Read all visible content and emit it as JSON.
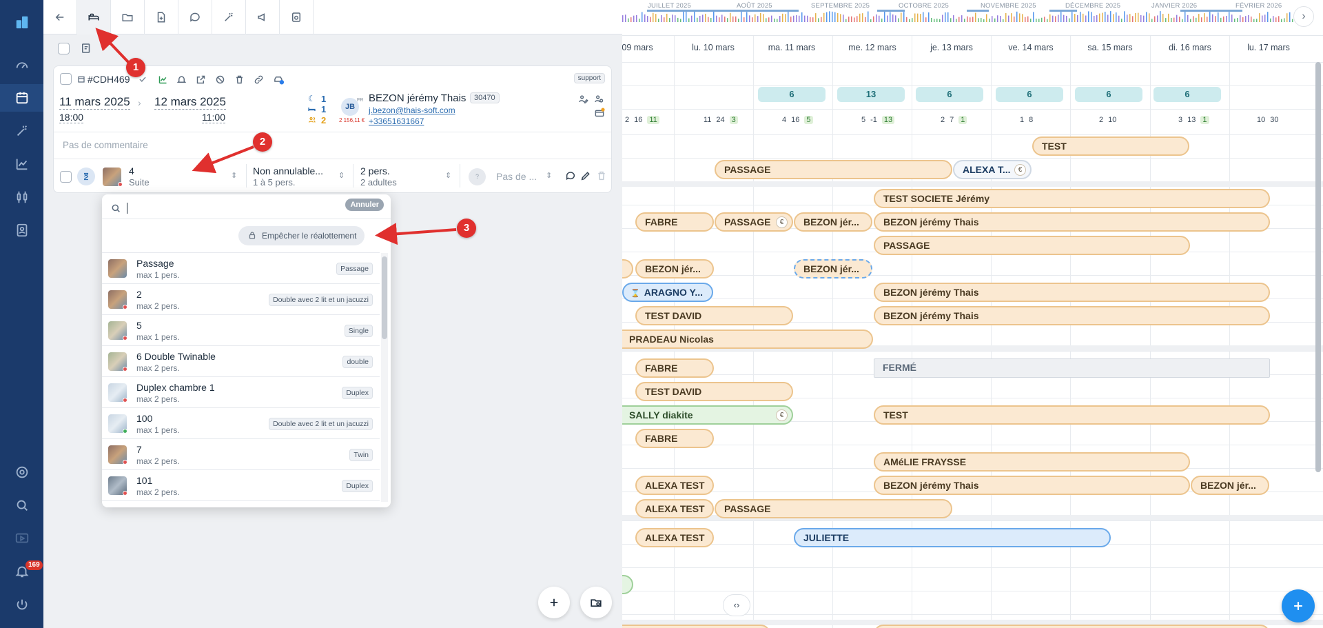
{
  "sidebar": {
    "notification_count": "169"
  },
  "booking": {
    "ref": "#CDH469",
    "support_label": "support",
    "arrival_date": "11 mars 2025",
    "arrival_time": "18:00",
    "departure_date": "12 mars 2025",
    "departure_time": "11:00",
    "nights": "1",
    "rooms": "1",
    "guests": "2",
    "initials": "JB",
    "lang": "FR",
    "amount": "2 156,11 €",
    "client_name": "BEZON jérémy Thais",
    "client_code": "30470",
    "email": "j.bezon@thais-soft.com",
    "phone": "+33651631667",
    "comment_placeholder": "Pas de commentaire"
  },
  "line": {
    "room_number": "4",
    "room_type": "Suite",
    "rate": "Non annulable...",
    "rate_sub": "1 à 5 pers.",
    "pax": "2 pers.",
    "pax_sub": "2 adultes",
    "note": "Pas de ...",
    "unknown": "?"
  },
  "dropdown": {
    "cancel_label": "Annuler",
    "lock_label": "Empêcher le réalottement",
    "rooms": [
      {
        "name": "Passage",
        "cap": "max 1 pers.",
        "tag": "Passage"
      },
      {
        "name": "2",
        "cap": "max 2 pers.",
        "tag": "Double avec 2 lit et un jacuzzi"
      },
      {
        "name": "5",
        "cap": "max 1 pers.",
        "tag": "Single"
      },
      {
        "name": "6 Double Twinable",
        "cap": "max 2 pers.",
        "tag": "double"
      },
      {
        "name": "Duplex chambre 1",
        "cap": "max 2 pers.",
        "tag": "Duplex"
      },
      {
        "name": "100",
        "cap": "max 1 pers.",
        "tag": "Double avec 2 lit et un jacuzzi"
      },
      {
        "name": "7",
        "cap": "max 2 pers.",
        "tag": "Twin"
      },
      {
        "name": "101",
        "cap": "max 2 pers.",
        "tag": "Duplex"
      }
    ]
  },
  "markers": [
    "1",
    "2",
    "3"
  ],
  "calendar": {
    "months": [
      "JUILLET 2025",
      "AOÛT 2025",
      "SEPTEMBRE 2025",
      "OCTOBRE 2025",
      "NOVEMBRE 2025",
      "DÉCEMBRE 2025",
      "JANVIER 2026",
      "FÉVRIER 2026"
    ],
    "days": [
      "09 mars",
      "lu. 10 mars",
      "ma. 11 mars",
      "me. 12 mars",
      "je. 13 mars",
      "ve. 14 mars",
      "sa. 15 mars",
      "di. 16 mars",
      "lu. 17 mars"
    ],
    "counts": [
      "6",
      "13",
      "6",
      "6",
      "6",
      "6"
    ],
    "stats": [
      [
        "2",
        "16",
        "11"
      ],
      [
        "11",
        "24",
        "3"
      ],
      [
        "4",
        "16",
        "5"
      ],
      [
        "5",
        "-1",
        "13"
      ],
      [
        "2",
        "7",
        "1"
      ],
      [
        "1",
        "8",
        ""
      ],
      [
        "2",
        "10",
        ""
      ],
      [
        "3",
        "13",
        "1"
      ],
      [
        "10",
        "30",
        ""
      ]
    ],
    "bars": {
      "test1": "TEST",
      "passage1": "PASSAGE",
      "alexa_t": "ALEXA T...",
      "test_societe": "TEST SOCIETE Jérémy",
      "fabre1": "FABRE",
      "passage2": "PASSAGE",
      "bezon1": "BEZON jér...",
      "bezon_long1": "BEZON jérémy Thais",
      "passage3": "PASSAGE",
      "bezon2": "BEZON jér...",
      "bezon3": "BEZON jér...",
      "aragno": "ARAGNO Y...",
      "bezon_long2": "BEZON jérémy Thais",
      "test_david1": "TEST DAVID",
      "bezon_long3": "BEZON jérémy Thais",
      "pradeau": "PRADEAU Nicolas",
      "fabre2": "FABRE",
      "ferme": "FERMÉ",
      "test_david2": "TEST DAVID",
      "sally": "SALLY diakite",
      "test2": "TEST",
      "fabre3": "FABRE",
      "amelie": "AMéLIE FRAYSSE",
      "alexa1": "ALEXA TEST",
      "bezon_long4": "BEZON jérémy Thais",
      "bezon4": "BEZON jér...",
      "alexa2": "ALEXA TEST",
      "passage4": "PASSAGE",
      "alexa3": "ALEXA TEST",
      "juliette": "JULIETTE"
    }
  }
}
